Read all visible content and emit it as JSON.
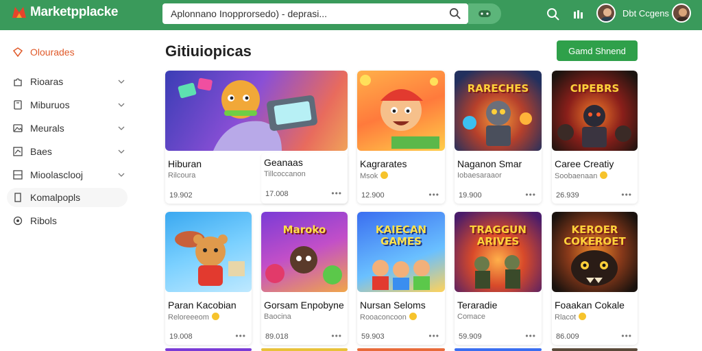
{
  "header": {
    "app_name": "Marketpplacke",
    "search_value": "Aplonnano Inopprorsedo) - deprasi...",
    "user_name": "Dbt Ccgens"
  },
  "sidebar": {
    "items": [
      {
        "label": "Olourades",
        "icon": "tag-icon",
        "has_chevron": false
      },
      {
        "label": "Rioaras",
        "icon": "puzzle-icon",
        "has_chevron": true
      },
      {
        "label": "Miburuos",
        "icon": "book-icon",
        "has_chevron": true
      },
      {
        "label": "Meurals",
        "icon": "image-icon",
        "has_chevron": true
      },
      {
        "label": "Baes",
        "icon": "chart-icon",
        "has_chevron": true
      },
      {
        "label": "Mioolasclooj",
        "icon": "grid-icon",
        "has_chevron": true
      },
      {
        "label": "Komalpopls",
        "icon": "bookmark-icon",
        "has_chevron": false
      },
      {
        "label": "Ribols",
        "icon": "settings-icon",
        "has_chevron": false
      }
    ]
  },
  "main": {
    "title": "Gitiuiopicas",
    "cta_label": "Gamd Shnend",
    "cards": [
      {
        "title": "Hiburan",
        "subtitle": "Rilcoura",
        "price": "19.902",
        "thumb_text": "",
        "emoji": false
      },
      {
        "title": "Geanaas",
        "subtitle": "Tillcoccanon",
        "price": "17.008",
        "thumb_text": "",
        "emoji": false
      },
      {
        "title": "Kagrarates",
        "subtitle": "Msok",
        "price": "12.900",
        "thumb_text": "",
        "emoji": true
      },
      {
        "title": "Naganon Smar",
        "subtitle": "Iobaesaraaor",
        "price": "19.900",
        "thumb_text": "RARECHES",
        "emoji": false
      },
      {
        "title": "Caree Creatiy",
        "subtitle": "Soobaenaan",
        "price": "26.939",
        "thumb_text": "CIPEBRS",
        "emoji": true
      },
      {
        "title": "Paran Kacobian",
        "subtitle": "Reloreeeom",
        "price": "19.008",
        "thumb_text": "",
        "emoji": true
      },
      {
        "title": "Gorsam Enpobyne",
        "subtitle": "Baocina",
        "price": "89.018",
        "thumb_text": "Maroko",
        "emoji": false
      },
      {
        "title": "Nursan Seloms",
        "subtitle": "Rooaconcoon",
        "price": "59.903",
        "thumb_text": "KAIECAN GAMES",
        "emoji": true
      },
      {
        "title": "Teraradie",
        "subtitle": "Comace",
        "price": "59.909",
        "thumb_text": "TRAGGUN ARIVES",
        "emoji": false
      },
      {
        "title": "Foaakan Cokale",
        "subtitle": "Rlacot",
        "price": "86.009",
        "thumb_text": "KEROER COKEROET",
        "emoji": true
      }
    ],
    "more_label": "•••"
  },
  "colors": {
    "header_green": "#3a9a5b",
    "cta_green": "#2fa04a",
    "accent_orange": "#e05a2a"
  }
}
